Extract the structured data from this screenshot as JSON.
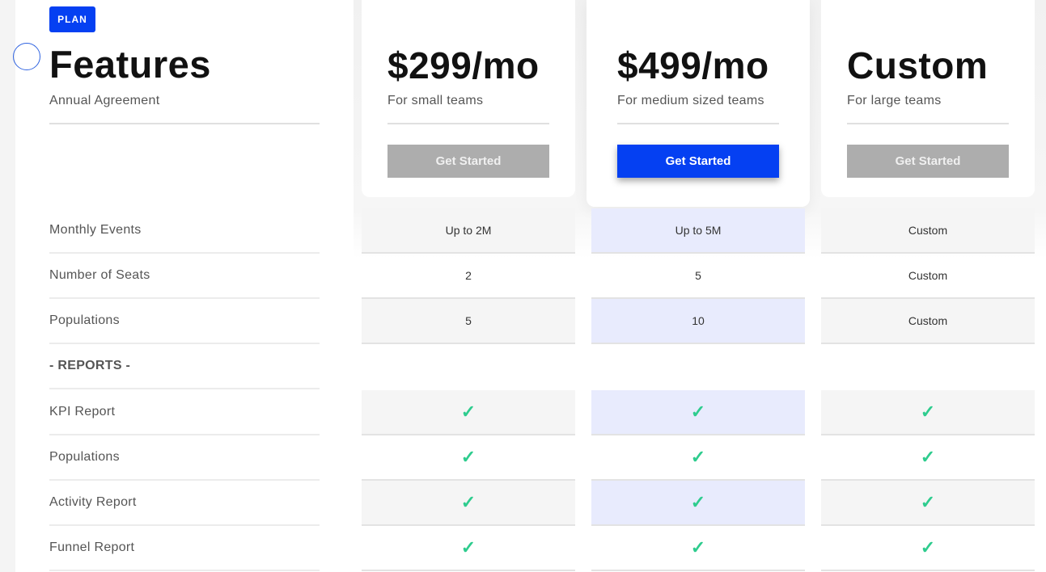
{
  "header": {
    "badge": "PLAN",
    "title": "Features",
    "subtitle": "Annual Agreement"
  },
  "plans": [
    {
      "price": "$299/mo",
      "subtitle": "For small teams",
      "button_label": "Get Started",
      "highlighted": false
    },
    {
      "price": "$499/mo",
      "subtitle": "For medium sized teams",
      "button_label": "Get Started",
      "highlighted": true
    },
    {
      "price": "Custom",
      "subtitle": "For large teams",
      "button_label": "Get Started",
      "highlighted": false
    }
  ],
  "colors": {
    "accent": "#0540f2",
    "button_disabled": "#adadad",
    "check": "#2ecc8e",
    "highlight_column": "#e8ebfd"
  },
  "rows": [
    {
      "label": "Monthly Events",
      "section": false,
      "values": [
        "Up to 2M",
        "Up to 5M",
        "Custom"
      ]
    },
    {
      "label": "Number of Seats",
      "section": false,
      "values": [
        "2",
        "5",
        "Custom"
      ]
    },
    {
      "label": "Populations",
      "section": false,
      "values": [
        "5",
        "10",
        "Custom"
      ]
    },
    {
      "label": "- REPORTS -",
      "section": true,
      "values": [
        "",
        "",
        ""
      ]
    },
    {
      "label": "KPI Report",
      "section": false,
      "values": [
        "✓",
        "✓",
        "✓"
      ]
    },
    {
      "label": "Populations",
      "section": false,
      "values": [
        "✓",
        "✓",
        "✓"
      ]
    },
    {
      "label": "Activity Report",
      "section": false,
      "values": [
        "✓",
        "✓",
        "✓"
      ]
    },
    {
      "label": "Funnel Report",
      "section": false,
      "values": [
        "✓",
        "✓",
        "✓"
      ]
    }
  ]
}
